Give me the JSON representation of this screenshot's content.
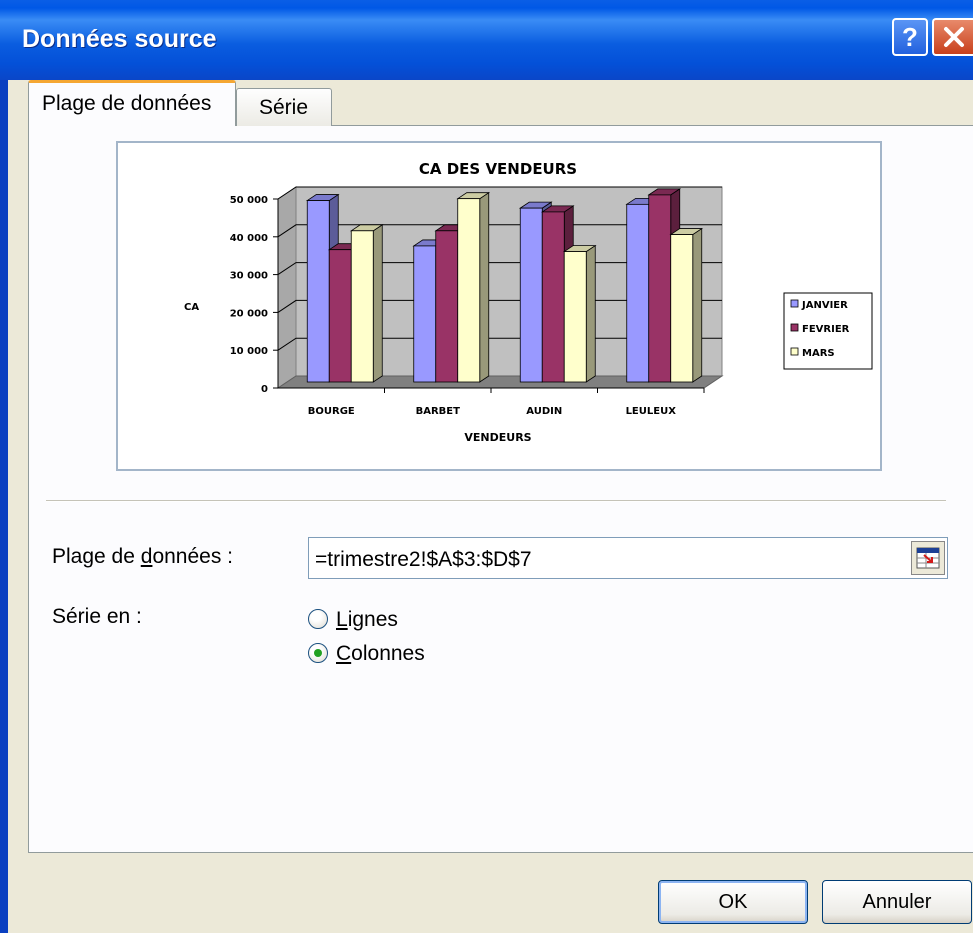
{
  "window": {
    "title": "Données source"
  },
  "tabs": [
    {
      "label": "Plage de données"
    },
    {
      "label": "Série"
    }
  ],
  "chart_data": {
    "type": "bar",
    "title": "CA DES VENDEURS",
    "xlabel": "VENDEURS",
    "ylabel": "CA",
    "categories": [
      "BOURGE",
      "BARBET",
      "AUDIN",
      "LEULEUX"
    ],
    "series": [
      {
        "name": "JANVIER",
        "values": [
          48000,
          36000,
          46000,
          47000
        ]
      },
      {
        "name": "FEVRIER",
        "values": [
          35000,
          40000,
          45000,
          49500
        ]
      },
      {
        "name": "MARS",
        "values": [
          40000,
          48500,
          34500,
          39000
        ]
      }
    ],
    "ylim": [
      0,
      50000
    ],
    "yticks": [
      "0",
      "10 000",
      "20 000",
      "30 000",
      "40 000",
      "50 000"
    ],
    "legend_position": "right",
    "grid": true,
    "colors": [
      "#9999ff",
      "#993366",
      "#ffffcc"
    ]
  },
  "range": {
    "label_prefix": "Plage de ",
    "label_accel": "d",
    "label_suffix": "onnées :",
    "value": "=trimestre2!$A$3:$D$7"
  },
  "series_in": {
    "label": "Série en :",
    "options": [
      {
        "accel": "L",
        "rest": "ignes",
        "selected": false
      },
      {
        "accel": "C",
        "rest": "olonnes",
        "selected": true
      }
    ]
  },
  "buttons": {
    "ok": "OK",
    "cancel": "Annuler"
  }
}
